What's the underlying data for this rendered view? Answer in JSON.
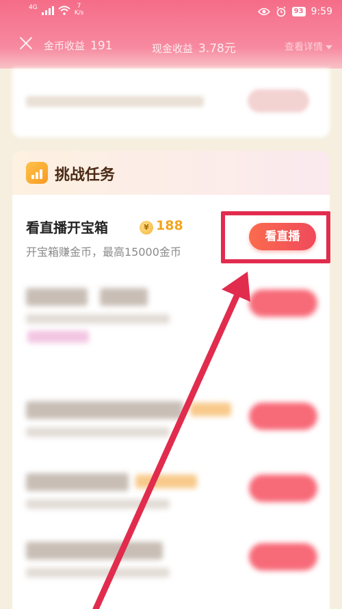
{
  "status_bar": {
    "network": "4G",
    "speed_value": "7",
    "speed_unit": "K/s",
    "battery": "93",
    "time": "9:59"
  },
  "top_bar": {
    "coin_income_label": "金币收益",
    "coin_income_value": "191",
    "cash_income_label": "现金收益",
    "cash_income_value": "3.78元",
    "details_label": "查看详情"
  },
  "task_card": {
    "title": "挑战任务",
    "task": {
      "name": "看直播开宝箱",
      "coin_symbol": "¥",
      "coin_amount": "188",
      "description": "开宝箱赚金币，最高15000金币",
      "button_label": "看直播"
    }
  },
  "colors": {
    "header": "#f56c88",
    "accent": "#f04a5b",
    "highlight": "#e12c4e",
    "coin": "#f3a51d"
  }
}
